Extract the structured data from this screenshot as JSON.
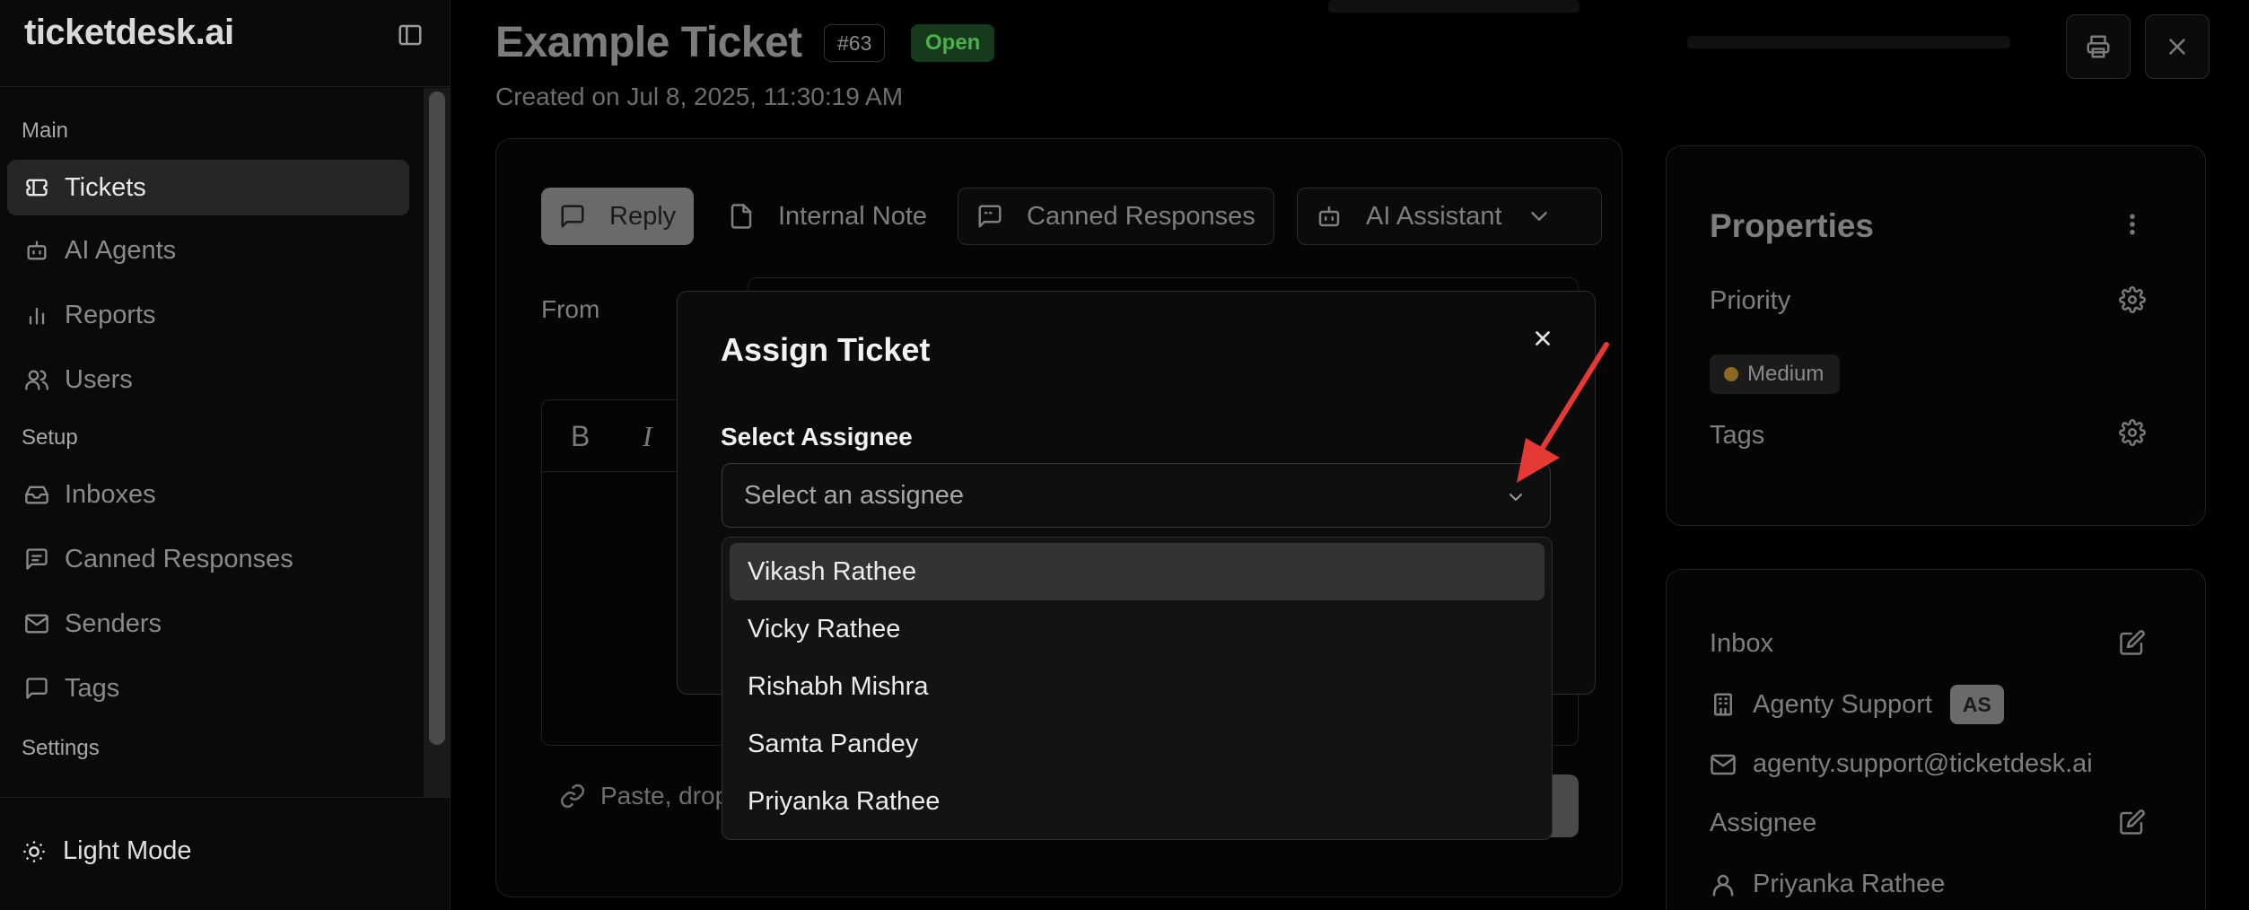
{
  "app": {
    "logo": "ticketdesk.ai"
  },
  "sidebar": {
    "sections": {
      "main": "Main",
      "setup": "Setup",
      "settings": "Settings"
    },
    "items": [
      {
        "label": "Tickets",
        "icon": "ticket-icon",
        "active": true
      },
      {
        "label": "AI Agents",
        "icon": "bot-icon",
        "active": false
      },
      {
        "label": "Reports",
        "icon": "bar-chart-icon",
        "active": false
      },
      {
        "label": "Users",
        "icon": "users-icon",
        "active": false
      },
      {
        "label": "Inboxes",
        "icon": "inbox-icon",
        "active": false
      },
      {
        "label": "Canned Responses",
        "icon": "message-square-icon",
        "active": false
      },
      {
        "label": "Senders",
        "icon": "mail-icon",
        "active": false
      },
      {
        "label": "Tags",
        "icon": "tag-icon",
        "active": false
      }
    ],
    "footer": {
      "light_mode": "Light Mode",
      "icon": "sun-icon"
    }
  },
  "ticket": {
    "title": "Example Ticket",
    "id": "#63",
    "status": "Open",
    "created": "Created on Jul 8, 2025, 11:30:19 AM"
  },
  "composer": {
    "tabs": {
      "reply": "Reply",
      "internal_note": "Internal Note",
      "canned": "Canned Responses",
      "ai": "AI Assistant"
    },
    "from_label": "From",
    "bold": "B",
    "italic": "I",
    "attach_text": "Paste, drop"
  },
  "properties": {
    "title": "Properties",
    "priority_label": "Priority",
    "priority_value": "Medium",
    "tags_label": "Tags"
  },
  "info": {
    "inbox_label": "Inbox",
    "inbox_name": "Agenty Support",
    "inbox_badge": "AS",
    "inbox_email": "agenty.support@ticketdesk.ai",
    "assignee_label": "Assignee",
    "assignee_name": "Priyanka Rathee"
  },
  "modal": {
    "title": "Assign Ticket",
    "field_label": "Select Assignee",
    "placeholder": "Select an assignee",
    "options": [
      "Vikash Rathee",
      "Vicky Rathee",
      "Rishabh Mishra",
      "Samta Pandey",
      "Priyanka Rathee"
    ],
    "highlighted_index": 0
  },
  "colors": {
    "status_open": "#4caf50",
    "annotation_arrow": "#e53935",
    "priority_medium": "#8a6a22"
  }
}
